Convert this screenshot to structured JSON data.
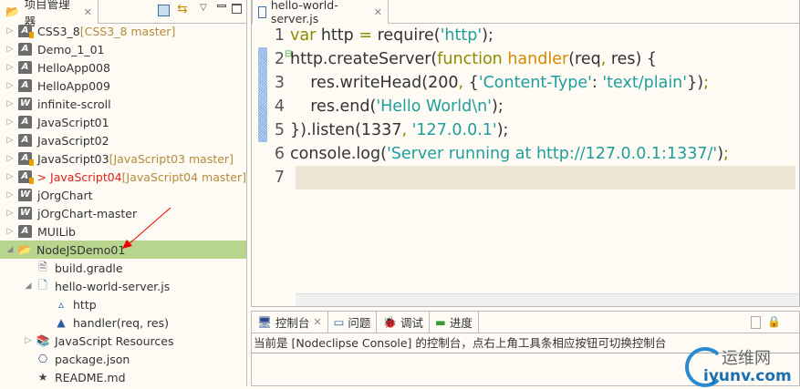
{
  "explorer": {
    "title": "项目管理器",
    "items": [
      {
        "label": "CSS3_8",
        "dec": "[CSS3_8 master]",
        "icon": "A",
        "git": true,
        "depth": 0,
        "tw": "▷"
      },
      {
        "label": "Demo_1_01",
        "icon": "A",
        "depth": 0,
        "tw": "▷"
      },
      {
        "label": "HelloApp008",
        "icon": "A",
        "depth": 0,
        "tw": "▷"
      },
      {
        "label": "HelloApp009",
        "icon": "A",
        "depth": 0,
        "tw": "▷"
      },
      {
        "label": "infinite-scroll",
        "icon": "W",
        "depth": 0,
        "tw": "▷"
      },
      {
        "label": "JavaScript01",
        "icon": "A",
        "depth": 0,
        "tw": "▷"
      },
      {
        "label": "JavaScript02",
        "icon": "A",
        "depth": 0,
        "tw": "▷"
      },
      {
        "label": "JavaScript03",
        "dec": "[JavaScript03 master]",
        "icon": "A",
        "git": true,
        "depth": 0,
        "tw": "▷"
      },
      {
        "label": "> JavaScript04",
        "dec": "[JavaScript04 master]",
        "icon": "A",
        "git": true,
        "red": true,
        "depth": 0,
        "tw": "▷"
      },
      {
        "label": "jOrgChart",
        "icon": "W",
        "depth": 0,
        "tw": "▷"
      },
      {
        "label": "jOrgChart-master",
        "icon": "W",
        "depth": 0,
        "tw": "▷"
      },
      {
        "label": "MUILib",
        "icon": "A",
        "depth": 0,
        "tw": "▷"
      },
      {
        "label": "NodeJSDemo01",
        "icon": "folder",
        "depth": 0,
        "tw": "◢",
        "selected": true
      },
      {
        "label": "build.gradle",
        "icon": "file",
        "depth": 1,
        "tw": ""
      },
      {
        "label": "hello-world-server.js",
        "icon": "js",
        "depth": 1,
        "tw": "◢"
      },
      {
        "label": "http",
        "icon": "tri-open",
        "depth": 2,
        "tw": ""
      },
      {
        "label": "handler(req, res)",
        "icon": "tri",
        "depth": 2,
        "tw": ""
      },
      {
        "label": "JavaScript Resources",
        "icon": "books",
        "depth": 1,
        "tw": "▷"
      },
      {
        "label": "package.json",
        "icon": "json",
        "depth": 1,
        "tw": ""
      },
      {
        "label": "README.md",
        "icon": "star",
        "depth": 1,
        "tw": ""
      }
    ]
  },
  "editor": {
    "tab": "hello-world-server.js",
    "lines": [
      {
        "n": "1",
        "tokens": [
          [
            "var",
            "k"
          ],
          [
            " http ",
            ""
          ],
          [
            "=",
            "k"
          ],
          [
            " require(",
            ""
          ],
          [
            "'http'",
            "s"
          ],
          [
            ");",
            ""
          ]
        ]
      },
      {
        "n": "2",
        "tokens": [
          [
            "http.createServer(",
            ""
          ],
          [
            "function",
            "k"
          ],
          [
            " ",
            ""
          ],
          [
            "handler",
            "f"
          ],
          [
            "(req",
            ""
          ],
          [
            ",",
            "k"
          ],
          [
            " res) {",
            ""
          ]
        ]
      },
      {
        "n": "3",
        "tokens": [
          [
            "    res.writeHead(200",
            ""
          ],
          [
            ",",
            "k"
          ],
          [
            " {",
            ""
          ],
          [
            "'Content-Type'",
            "s"
          ],
          [
            ": ",
            ""
          ],
          [
            "'text/plain'",
            "s"
          ],
          [
            "})",
            ""
          ],
          [
            ";",
            "k"
          ]
        ]
      },
      {
        "n": "4",
        "tokens": [
          [
            "    res.end(",
            ""
          ],
          [
            "'Hello World\\n'",
            "s"
          ],
          [
            ");",
            ""
          ]
        ]
      },
      {
        "n": "5",
        "tokens": [
          [
            "}).listen(1337",
            ""
          ],
          [
            ",",
            "k"
          ],
          [
            " ",
            ""
          ],
          [
            "'127.0.0.1'",
            "s"
          ],
          [
            ");",
            ""
          ]
        ]
      },
      {
        "n": "6",
        "tokens": [
          [
            "console.log(",
            ""
          ],
          [
            "'Server running at http://127.0.0.1:1337/'",
            "s"
          ],
          [
            ")",
            ""
          ],
          [
            ";",
            "k"
          ]
        ]
      },
      {
        "n": "7",
        "tokens": []
      }
    ]
  },
  "console": {
    "tabs": [
      "控制台",
      "问题",
      "调试",
      "进度"
    ],
    "message": "当前是 [Nodeclipse Console] 的控制台，点右上角工具条相应按钮可切换控制台"
  },
  "watermark": {
    "text": "运维网",
    "url": "iyunv.com"
  },
  "colors": {
    "keyword": "#8c8c00",
    "string": "#1f9e9e",
    "func": "#d38b00",
    "selected": "#b8d58e"
  }
}
